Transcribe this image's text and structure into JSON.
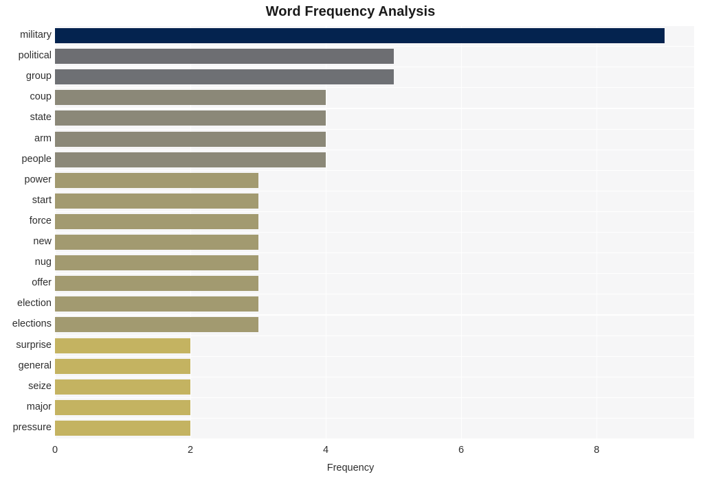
{
  "chart_data": {
    "type": "bar",
    "orientation": "horizontal",
    "title": "Word Frequency Analysis",
    "xlabel": "Frequency",
    "ylabel": "",
    "categories": [
      "military",
      "political",
      "group",
      "coup",
      "state",
      "arm",
      "people",
      "power",
      "start",
      "force",
      "new",
      "nug",
      "offer",
      "election",
      "elections",
      "surprise",
      "general",
      "seize",
      "major",
      "pressure"
    ],
    "values": [
      9,
      5,
      5,
      4,
      4,
      4,
      4,
      3,
      3,
      3,
      3,
      3,
      3,
      3,
      3,
      2,
      2,
      2,
      2,
      2
    ],
    "bar_colors": [
      "#04234f",
      "#6d6e72",
      "#6e7074",
      "#8b8878",
      "#8b8878",
      "#8b8878",
      "#8b8878",
      "#a29a70",
      "#a29a70",
      "#a29a70",
      "#a29a70",
      "#a29a70",
      "#a29a70",
      "#a29a70",
      "#a29a70",
      "#c4b361",
      "#c4b361",
      "#c4b361",
      "#c4b361",
      "#c4b361"
    ],
    "xticks": [
      0,
      2,
      4,
      6,
      8
    ],
    "xlim": [
      0,
      9.44
    ],
    "grid": true,
    "grid_color": "#ffffff",
    "plot_background": "#f6f6f7",
    "figure_background": "#ffffff",
    "legend": null
  },
  "axis": {
    "x_tick_labels": [
      "0",
      "2",
      "4",
      "6",
      "8"
    ],
    "x_title": "Frequency"
  }
}
